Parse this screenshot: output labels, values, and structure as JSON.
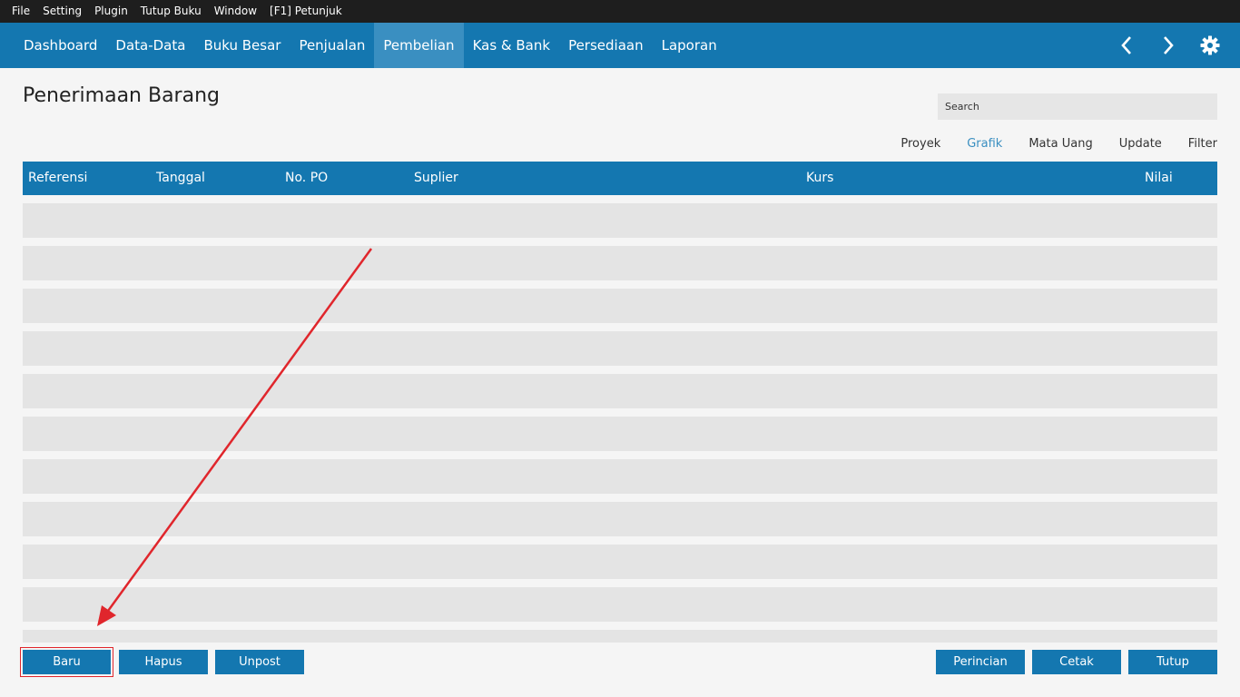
{
  "menubar": [
    "File",
    "Setting",
    "Plugin",
    "Tutup Buku",
    "Window",
    "[F1] Petunjuk"
  ],
  "nav": {
    "items": [
      "Dashboard",
      "Data-Data",
      "Buku Besar",
      "Penjualan",
      "Pembelian",
      "Kas & Bank",
      "Persediaan",
      "Laporan"
    ],
    "active": "Pembelian",
    "icons": [
      "chevron-left-icon",
      "chevron-right-icon",
      "gear-icon"
    ]
  },
  "page": {
    "title": "Penerimaan Barang"
  },
  "search": {
    "placeholder": "Search",
    "value": ""
  },
  "filters": [
    "Proyek",
    "Grafik",
    "Mata Uang",
    "Update",
    "Filter"
  ],
  "filters_active": "Grafik",
  "table": {
    "columns": [
      "Referensi",
      "Tanggal",
      "No. PO",
      "Suplier",
      "Kurs",
      "Nilai"
    ],
    "rows": []
  },
  "buttons": {
    "left": [
      "Baru",
      "Hapus",
      "Unpost"
    ],
    "right": [
      "Perincian",
      "Cetak",
      "Tutup"
    ]
  },
  "colors": {
    "accent": "#1477b0",
    "active_tab": "#3a8fc1",
    "annotation": "#e0262c"
  }
}
